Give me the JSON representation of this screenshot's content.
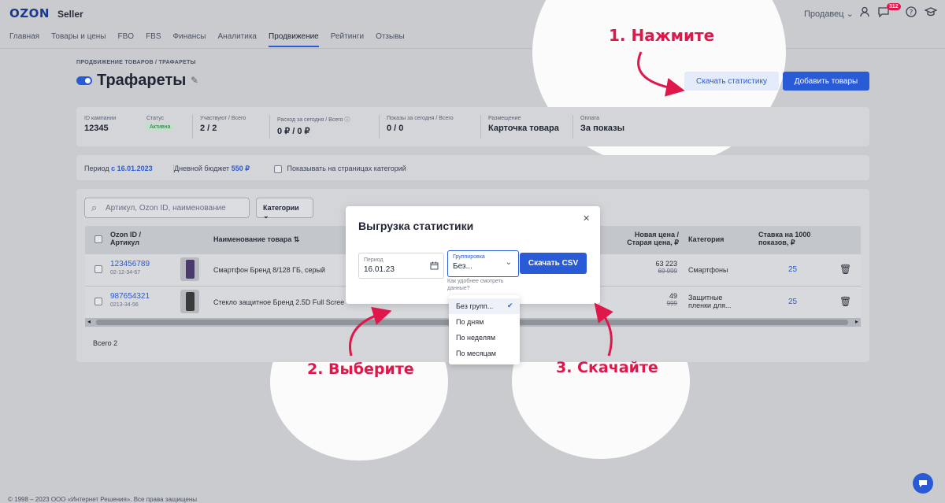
{
  "header": {
    "logo": "OZON",
    "logo_sub": "Seller",
    "user_menu": "Продавец ⌄",
    "notifications_count": "312"
  },
  "nav": [
    "Главная",
    "Товары и цены",
    "FBO",
    "FBS",
    "Финансы",
    "Аналитика",
    "Продвижение",
    "Рейтинги",
    "Отзывы"
  ],
  "nav_active": "Продвижение",
  "breadcrumb": "ПРОДВИЖЕНИЕ ТОВАРОВ  /  ТРАФАРЕТЫ",
  "page_title": "Трафареты",
  "buttons": {
    "download_stats": "Скачать статистику",
    "add_products": "Добавить товары"
  },
  "campaign": {
    "id_label": "ID кампании",
    "id_value": "12345",
    "status_label": "Статус",
    "status_value": "Активна",
    "participate_label": "Участвуют / Всего",
    "participate_value": "2 / 2",
    "spend_label": "Расход за сегодня / Всего ⓘ",
    "spend_value": "0 ₽ / 0 ₽",
    "views_label": "Показы за сегодня / Всего",
    "views_value": "0 / 0",
    "placement_label": "Размещение",
    "placement_value": "Карточка товара",
    "payment_label": "Оплата",
    "payment_value": "За показы"
  },
  "period": {
    "label": "Период",
    "value": "с 16.01.2023",
    "budget_label": "Дневной бюджет",
    "budget_value": "550 ₽",
    "show_on_categories": "Показывать на страницах категорий"
  },
  "search": {
    "placeholder": "Артикул, Ozon ID, наименование"
  },
  "categories_button": "Категории ⌄",
  "table": {
    "headers": {
      "id": "Ozon ID / Артикул",
      "name": "Наименование товара ⇅",
      "price": "Новая цена / Старая цена, ₽",
      "category": "Категория",
      "bid": "Ставка на 1000 показов, ₽"
    },
    "rows": [
      {
        "id": "123456789",
        "article": "02-12-34-67",
        "name": "Смартфон Бренд 8/128 ГБ, серый",
        "price_new": "63 223",
        "price_old": "69 999",
        "category": "Смартфоны",
        "bid": "25"
      },
      {
        "id": "987654321",
        "article": "0213-34-56",
        "name": "Стекло защитное Бренд 2.5D Full Scree",
        "price_new": "49",
        "price_old": "999",
        "category": "Защитные пленки для...",
        "bid": "25"
      }
    ],
    "total": "Всего 2"
  },
  "modal": {
    "title": "Выгрузка статистики",
    "period_label": "Период",
    "period_value": "16.01.23",
    "grouping_label": "Группировка",
    "grouping_value": "Без...",
    "hint": "Как удобнее смотреть данные?",
    "download_csv": "Скачать CSV"
  },
  "dropdown": [
    "Без групп...",
    "По дням",
    "По неделям",
    "По месяцам"
  ],
  "annotations": {
    "step1": "1. Нажмите",
    "step2": "2. Выберите",
    "step3": "3. Скачайте"
  },
  "footer": "© 1998 – 2023 ООО «Интернет Решения». Все права защищены",
  "colors": {
    "accent": "#2a5bd7",
    "annotation": "#e0174b"
  }
}
